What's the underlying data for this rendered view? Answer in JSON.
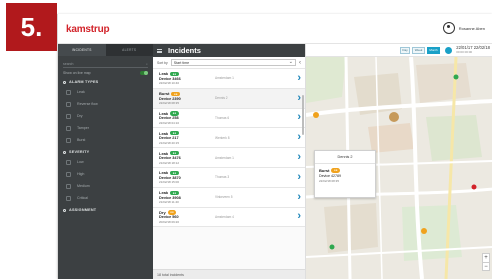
{
  "step_badge": "5.",
  "app": {
    "logo": "kamstrup",
    "user_name": "Rosanne Aben"
  },
  "sidebar": {
    "tabs": [
      "INCIDENTS",
      "ALERTS"
    ],
    "search_placeholder": "search",
    "toggle_label": "Show on live map",
    "sections": [
      {
        "title": "ALARM TYPES",
        "items": [
          "Leak",
          "Reverse flow",
          "Dry",
          "Tamper",
          "Burst"
        ]
      },
      {
        "title": "SEVERITY",
        "items": [
          "Low",
          "High",
          "Medium",
          "Critical"
        ]
      },
      {
        "title": "ASSIGNMENT",
        "items": []
      }
    ]
  },
  "list": {
    "title": "Incidents",
    "sort_label": "Sort by",
    "sort_value": "Start time",
    "rows": [
      {
        "type": "Leak",
        "device": "Device 3466",
        "time": "22/02/18 10:40",
        "note": "Amsterdam 1"
      },
      {
        "type": "Burst",
        "device": "Device 2390",
        "time": "22/02/18 08:35",
        "note": "Dennis 2"
      },
      {
        "type": "Leak",
        "device": "Device 258",
        "time": "22/02/18 04:10",
        "note": "Thomas 6"
      },
      {
        "type": "Leak",
        "device": "Device 217",
        "time": "21/02/18 20:15",
        "note": "Werkerk 8"
      },
      {
        "type": "Leak",
        "device": "Device 3476",
        "time": "21/02/18 18:12",
        "note": "Amsterdam 1"
      },
      {
        "type": "Leak",
        "device": "Device 3870",
        "time": "21/02/18 15:00",
        "note": "Thomas 3"
      },
      {
        "type": "Leak",
        "device": "Device 3908",
        "time": "21/02/18 11:40",
        "note": "Vinkeveen 5"
      },
      {
        "type": "Dry",
        "device": "Device 560",
        "time": "20/02/18 09:20",
        "note": "Amsterdam 4"
      }
    ],
    "footer": "18 total incidents"
  },
  "toolbar": {
    "buttons": [
      "Day",
      "Week",
      "Month"
    ],
    "active_button": "Month",
    "date_range": "22/01/17  22/02/18",
    "time_range": "00:00   00:00"
  },
  "map": {
    "popup_title": "Dennis 2",
    "popup_type": "Burst",
    "popup_device": "Device 42789",
    "popup_time": "22/02/18 08:35",
    "zoom_in": "+",
    "zoom_out": "−"
  }
}
